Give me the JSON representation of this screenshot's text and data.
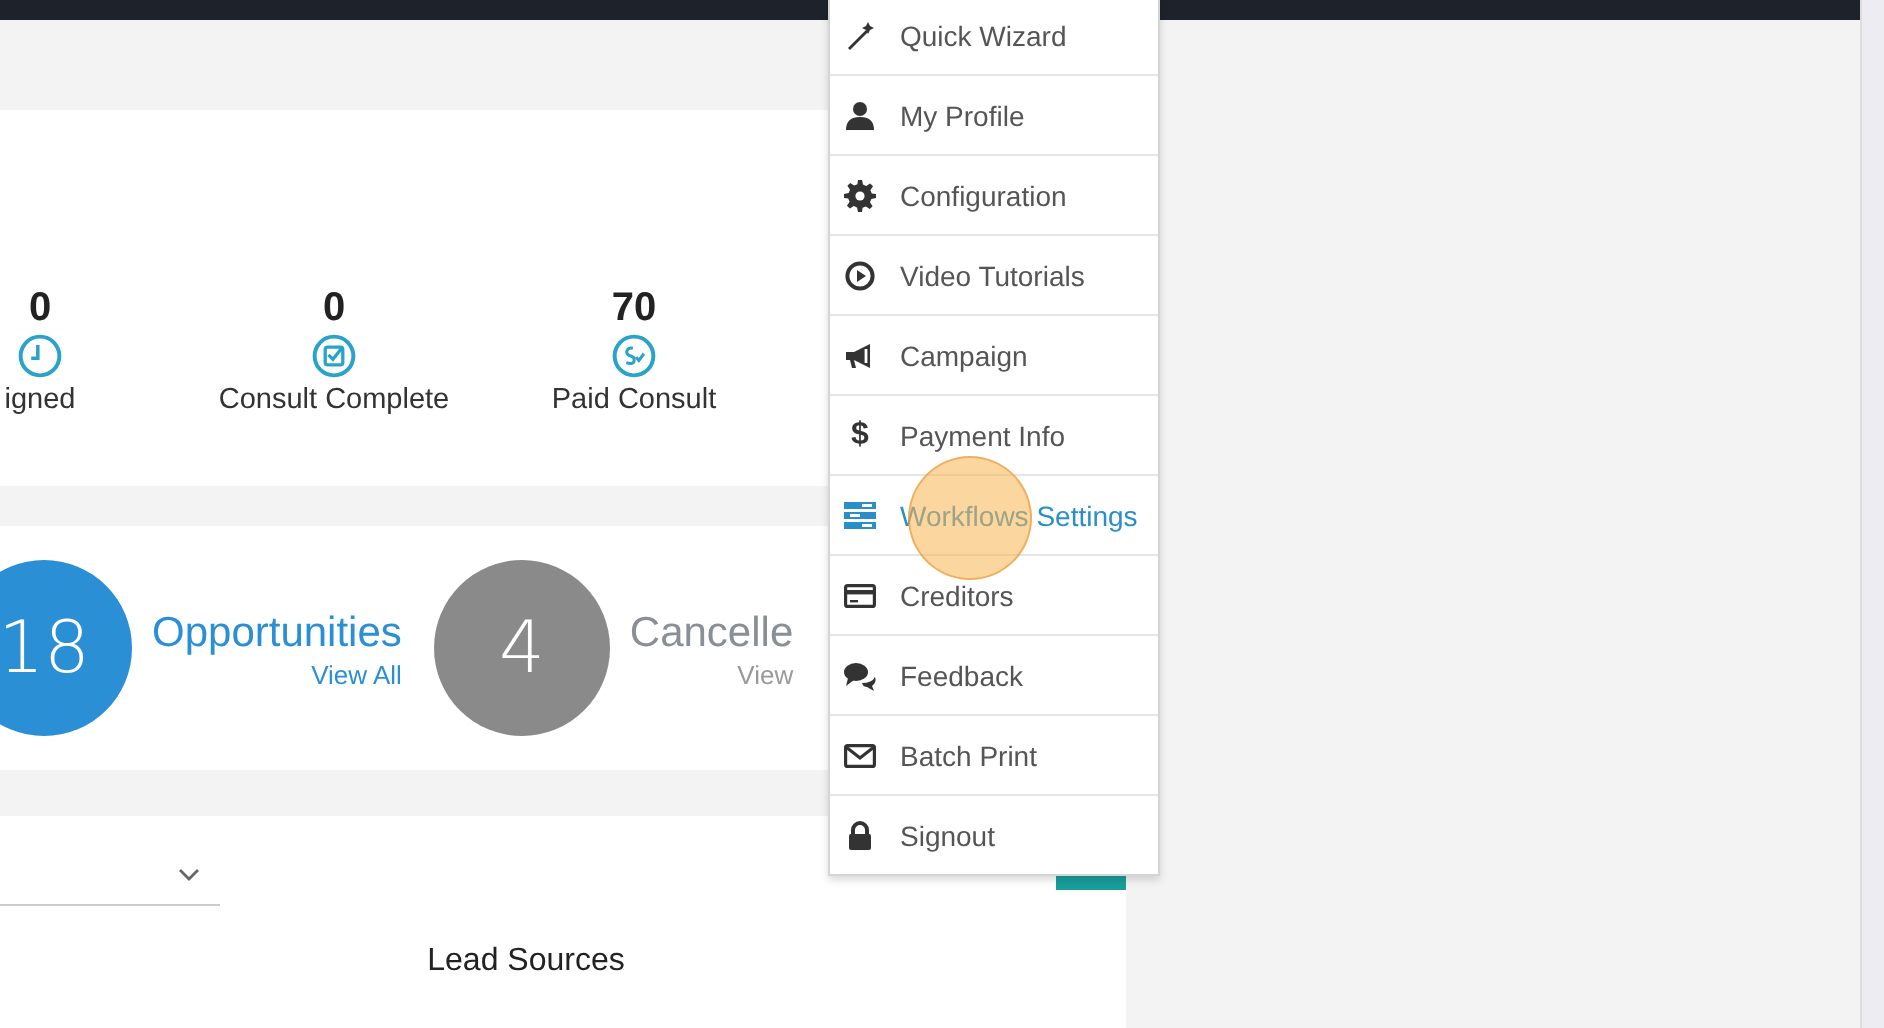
{
  "stats": [
    {
      "value": "0",
      "label": "igned"
    },
    {
      "value": "0",
      "label": "Consult Complete"
    },
    {
      "value": "70",
      "label": "Paid Consult"
    }
  ],
  "counters": [
    {
      "count": "18",
      "title": "Opportunities",
      "link": "View All",
      "color": "#2b8fd6"
    },
    {
      "count": "4",
      "title": "Cancelle",
      "link": "View",
      "color": "#8a8a8a"
    }
  ],
  "lead_sources": {
    "title": "Lead Sources"
  },
  "user_menu": {
    "items": [
      {
        "label": "Quick Wizard",
        "selected": false
      },
      {
        "label": "My Profile",
        "selected": false
      },
      {
        "label": "Configuration",
        "selected": false
      },
      {
        "label": "Video Tutorials",
        "selected": false
      },
      {
        "label": "Campaign",
        "selected": false
      },
      {
        "label": "Payment Info",
        "selected": false,
        "symbol": "$"
      },
      {
        "label": "Workflows Settings",
        "selected": true
      },
      {
        "label": "Creditors",
        "selected": false
      },
      {
        "label": "Feedback",
        "selected": false
      },
      {
        "label": "Batch Print",
        "selected": false
      },
      {
        "label": "Signout",
        "selected": false
      }
    ]
  }
}
